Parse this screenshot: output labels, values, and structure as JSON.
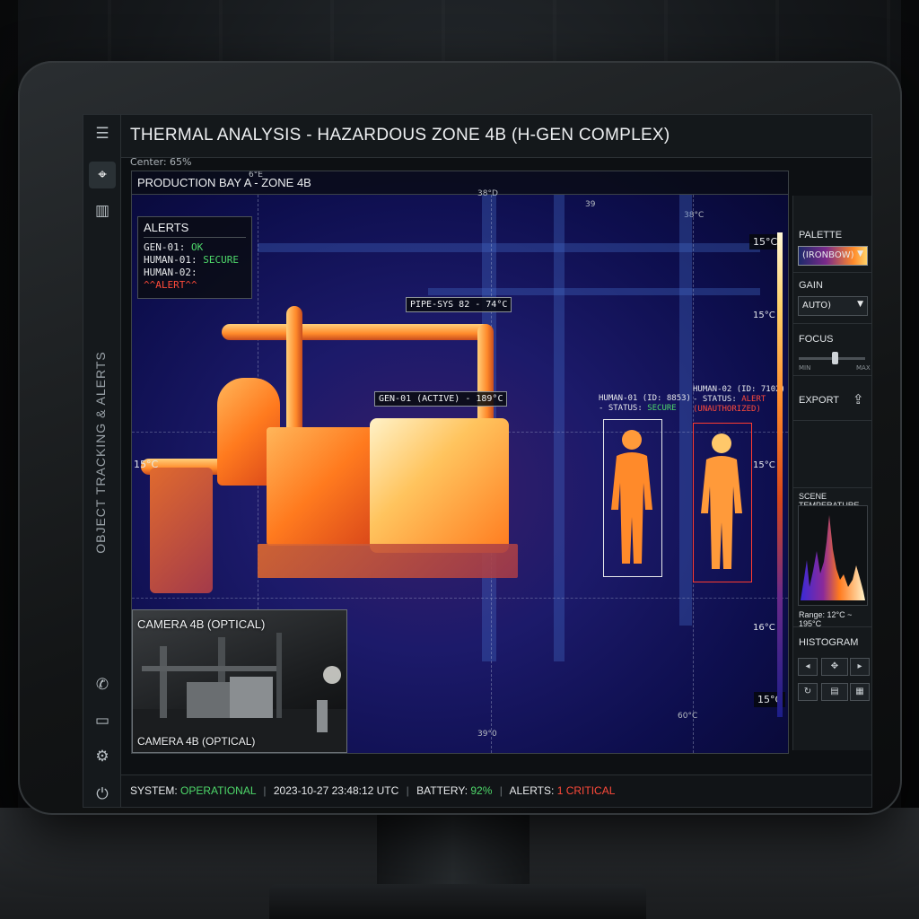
{
  "window": {
    "title": "THERMAL ANALYSIS - HAZARDOUS ZONE 4B (H-GEN COMPLEX)",
    "center_readout": "Center: 65%",
    "sidebar_label": "OBJECT TRACKING & ALERTS"
  },
  "viewport": {
    "title": "PRODUCTION BAY A - ZONE 4B",
    "scale_top": [
      "6°E",
      "38°D",
      "39",
      "38°C"
    ],
    "scale_bottom": [
      "39°0",
      "60°C"
    ],
    "temps": {
      "top_right": "15°C",
      "right_upper": "15°C",
      "left_mid": "15°C",
      "right_mid": "15°C",
      "right_lower": "16°C",
      "bottom_right": "15°C"
    }
  },
  "alerts": {
    "title": "ALERTS",
    "items": [
      {
        "name": "GEN-01:",
        "status": "OK",
        "level": "ok"
      },
      {
        "name": "HUMAN-01:",
        "status": "SECURE",
        "level": "ok"
      },
      {
        "name": "HUMAN-02:",
        "status": "^^ALERT^^",
        "level": "critical"
      }
    ]
  },
  "tags": {
    "pipe": "PIPE-SYS 82 - 74°C",
    "generator": "GEN-01 (ACTIVE) - 189°C"
  },
  "humans": [
    {
      "line1": "HUMAN-01 (ID: 8853)",
      "status_prefix": "- STATUS:",
      "status": "SECURE",
      "level": "ok"
    },
    {
      "line1": "HUMAN-02 (ID: 7102)",
      "status_prefix": "- STATUS:",
      "status": "ALERT",
      "extra": "(UNAUTHORIZED)",
      "level": "critical"
    }
  ],
  "pip": {
    "title": "CAMERA 4B (OPTICAL)",
    "caption": "CAMERA 4B (OPTICAL)"
  },
  "panel": {
    "palette_label": "PALETTE",
    "palette_value": "(IRONBOW)",
    "gain_label": "GAIN",
    "gain_value": "AUTO)",
    "focus_label": "FOCUS",
    "focus_min": "MIN",
    "focus_max": "MAX",
    "export_label": "EXPORT",
    "scene_label": "SCENE TEMPERATURE",
    "range_label": "Range: 12°C ~ 195°C",
    "histogram_label": "HISTOGRAM"
  },
  "status": {
    "system_label": "SYSTEM:",
    "system_value": "OPERATIONAL",
    "timestamp": "2023-10-27 23:48:12 UTC",
    "battery_label": "BATTERY:",
    "battery_value": "92%",
    "alerts_label": "ALERTS:",
    "alerts_value": "1 CRITICAL"
  },
  "colors": {
    "ok": "#4ed86a",
    "critical": "#ff4a3a",
    "palette": "ironbow"
  }
}
